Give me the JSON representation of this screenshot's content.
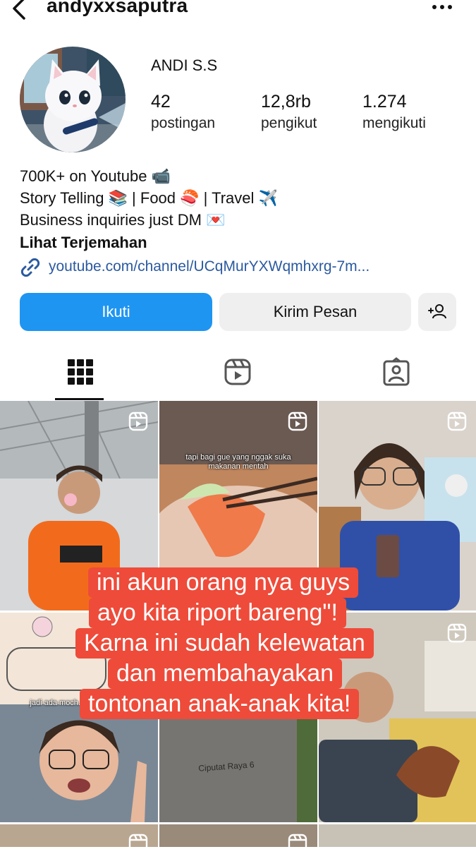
{
  "header": {
    "username": "andyxxsaputra",
    "back_icon": "chevron-left-icon",
    "more_icon": "more-dots-icon"
  },
  "profile": {
    "display_name": "ANDI S.S",
    "stats": [
      {
        "value": "42",
        "label": "postingan"
      },
      {
        "value": "12,8rb",
        "label": "pengikut"
      },
      {
        "value": "1.274",
        "label": "mengikuti"
      }
    ],
    "bio": [
      "700K+ on Youtube 📹",
      "Story Telling 📚 | Food 🍣 | Travel ✈️",
      "Business inquiries just DM 💌"
    ],
    "translate": "Lihat Terjemahan",
    "link": "youtube.com/channel/UCqMurYXWqmhxrg-7m..."
  },
  "actions": {
    "follow": "Ikuti",
    "message": "Kirim Pesan",
    "add_friend_icon": "add-person-icon"
  },
  "tabs": {
    "grid_icon": "grid-icon",
    "reels_icon": "reels-icon",
    "tagged_icon": "tagged-icon",
    "active": "grid"
  },
  "posts": {
    "captions": [
      "tapi bagi gue yang nggak suka makanan mentah",
      "jadi ada moch... makan m...",
      "Ciputat Raya 6"
    ]
  },
  "overlay": {
    "lines": [
      "ini akun orang nya guys",
      "ayo kita riport bareng\"!",
      "Karna ini sudah kelewatan",
      "dan membahayakan",
      "tontonan anak-anak kita!"
    ],
    "color": "#ee4b3a"
  },
  "colors": {
    "accent": "#1f95f2",
    "link": "#2b5aa0"
  }
}
